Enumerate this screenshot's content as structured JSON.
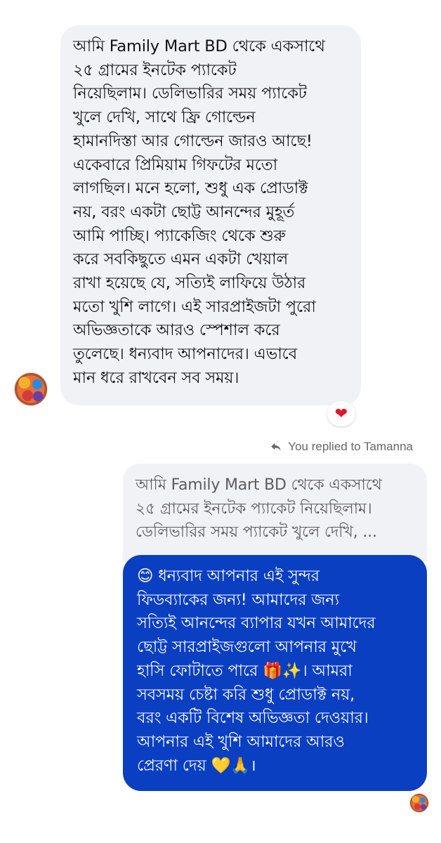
{
  "incoming_message": {
    "lines": [
      "আমি Family Mart BD থেকে একসাথে",
      "২৫ গ্রামের ইনটেক প্যাকেট",
      "নিয়েছিলাম। ডেলিভারির সময় প্যাকেট",
      "খুলে দেখি, সাথে ফ্রি গোল্ডেন",
      "হামানদিস্তা আর গোল্ডেন জারও আছে!",
      "একেবারে প্রিমিয়াম গিফটের মতো",
      "লাগছিল। মনে হলো, শুধু এক প্রোডাক্ট",
      "নয়, বরং একটা ছোট্ট আনন্দের মুহূর্ত",
      "আমি পাচ্ছি। প্যাকেজিং থেকে শুরু",
      "করে সবকিছুতে এমন একটা খেয়াল",
      "রাখা হয়েছে যে, সত্যিই লাফিয়ে উঠার",
      "মতো খুশি লাগে। এই সারপ্রাইজটা পুরো",
      "অভিজ্ঞতাকে আরও স্পেশাল করে",
      "তুলেছে। ধন্যবাদ আপনাদের। এভাবে",
      "মান ধরে রাখবেন সব সময়।"
    ],
    "reaction": "❤"
  },
  "reply_note": {
    "text": "You replied to Tamanna"
  },
  "quoted_message": {
    "lines": [
      "আমি Family Mart BD থেকে একসাথে",
      "২৫ গ্রামের ইনটেক প্যাকেট নিয়েছিলাম।",
      "ডেলিভারির সময় প্যাকেট খুলে দেখি, ..."
    ]
  },
  "outgoing_message": {
    "lines": [
      "😊 ধন্যবাদ আপনার এই সুন্দর",
      "ফিডব্যাকের জন্য! আমাদের জন্য",
      "সত্যিই আনন্দের ব্যাপার যখন আমাদের",
      "ছোট্ট সারপ্রাইজগুলো আপনার মুখে",
      "হাসি ফোটাতে পারে 🎁✨। আমরা",
      "সবসময় চেষ্টা করি শুধু প্রোডাক্ট নয়,",
      "বরং একটি বিশেষ অভিজ্ঞতা দেওয়ার।",
      "আপনার এই খুশি আমাদের আরও",
      "প্রেরণা দেয় 💛🙏।"
    ]
  },
  "colors": {
    "incoming_bubble": "#f1f2f6",
    "outgoing_bubble": "#0b3fc2",
    "reaction_heart": "#e0162b",
    "meta_text": "#65676b"
  }
}
